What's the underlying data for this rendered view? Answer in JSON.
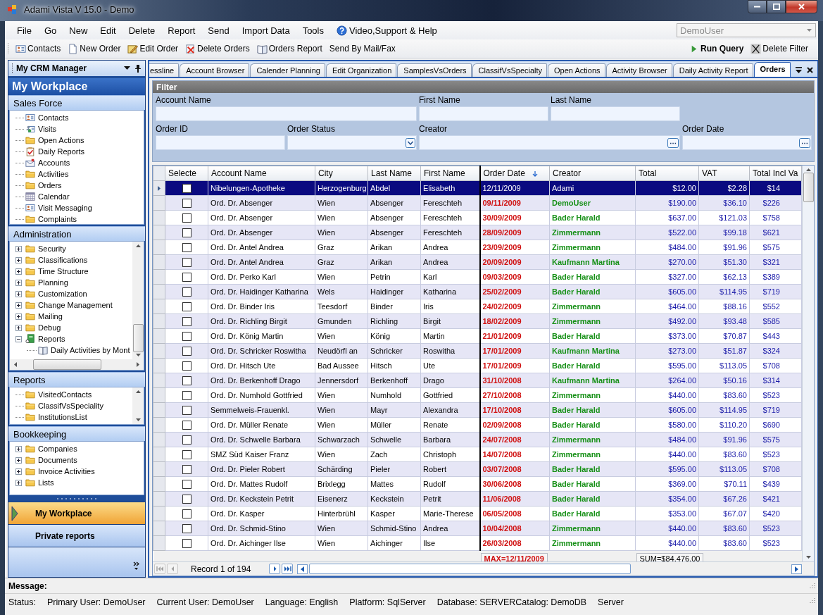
{
  "window": {
    "title": "Adami Vista V 15.0 - Demo"
  },
  "menu": [
    {
      "label": "File",
      "kind": "plain"
    },
    {
      "label": "Go",
      "kind": "plain"
    },
    {
      "label": "New",
      "kind": "plain"
    },
    {
      "label": "Edit",
      "kind": "plain"
    },
    {
      "label": "Delete",
      "kind": "plain"
    },
    {
      "label": "Report",
      "kind": "plain"
    },
    {
      "label": "Send",
      "kind": "plain"
    },
    {
      "label": "Import Data",
      "kind": "plain"
    },
    {
      "label": "Tools",
      "kind": "plain"
    },
    {
      "label": "Video,Support & Help",
      "kind": "help"
    }
  ],
  "user_combo": {
    "value": "DemoUser",
    "disabled": true
  },
  "toolbar": [
    {
      "label": "Contacts",
      "kind": "card"
    },
    {
      "label": "New Order",
      "kind": "document"
    },
    {
      "label": "Edit Order",
      "kind": "pencil"
    },
    {
      "label": "Delete Orders",
      "kind": "delete"
    },
    {
      "label": "Orders Report",
      "kind": "openbook"
    },
    {
      "label": "Send By Mail/Fax",
      "kind": "plain"
    }
  ],
  "query_toolbar": [
    {
      "label": "Run Query",
      "kind": "play"
    },
    {
      "label": "Delete Filter",
      "kind": "x"
    }
  ],
  "sidebar": {
    "title": "My CRM Manager",
    "workplace": "My Workplace",
    "groups": [
      {
        "title": "Sales Force",
        "kind": "flat",
        "items": [
          {
            "label": "Contacts",
            "kind": "card"
          },
          {
            "label": "Visits",
            "kind": "people"
          },
          {
            "label": "Open Actions",
            "kind": "folder"
          },
          {
            "label": "Daily Reports",
            "kind": "clipboard"
          },
          {
            "label": "Accounts",
            "kind": "envelope"
          },
          {
            "label": "Activities",
            "kind": "folder"
          },
          {
            "label": "Orders",
            "kind": "folder"
          },
          {
            "label": "Calendar",
            "kind": "calendar"
          },
          {
            "label": "Visit Messaging",
            "kind": "card"
          },
          {
            "label": "Complaints",
            "kind": "folder"
          }
        ]
      },
      {
        "title": "Administration",
        "kind": "scroll2",
        "items": [
          {
            "label": "Security",
            "kind": "folder",
            "expanded": false
          },
          {
            "label": "Classifications",
            "kind": "folder",
            "expanded": false
          },
          {
            "label": "Time Structure",
            "kind": "folder",
            "expanded": false
          },
          {
            "label": "Planning",
            "kind": "folder",
            "expanded": false
          },
          {
            "label": "Customization",
            "kind": "folder",
            "expanded": false
          },
          {
            "label": "Change Management",
            "kind": "folder",
            "expanded": false
          },
          {
            "label": "Mailing",
            "kind": "folder",
            "expanded": false
          },
          {
            "label": "Debug",
            "kind": "folder",
            "expanded": false
          },
          {
            "label": "Reports",
            "kind": "book",
            "expanded": true,
            "children": [
              {
                "label": "Daily Activities by Mont",
                "kind": "openbook"
              }
            ]
          }
        ]
      },
      {
        "title": "Reports",
        "kind": "scroll1",
        "items": [
          {
            "label": "VisitedContacts",
            "kind": "folder"
          },
          {
            "label": "ClassifVsSpeciality",
            "kind": "folder"
          },
          {
            "label": "InstitutionsList",
            "kind": "folder"
          }
        ]
      },
      {
        "title": "Bookkeeping",
        "kind": "flat",
        "items": [
          {
            "label": "Companies",
            "kind": "folder",
            "expanded": false
          },
          {
            "label": "Documents",
            "kind": "folder",
            "expanded": false
          },
          {
            "label": "Invoice Activities",
            "kind": "folder",
            "expanded": false
          },
          {
            "label": "Lists",
            "kind": "folder",
            "expanded": false
          }
        ]
      }
    ],
    "nav_buttons": [
      {
        "label": "My Workplace",
        "selected": true
      },
      {
        "label": "Private reports",
        "selected": false
      }
    ]
  },
  "tabs": [
    {
      "label": "essline",
      "selected": false
    },
    {
      "label": "Account Browser",
      "selected": false
    },
    {
      "label": "Calender Planning",
      "selected": false
    },
    {
      "label": "Edit Organization",
      "selected": false
    },
    {
      "label": "SamplesVsOrders",
      "selected": false
    },
    {
      "label": "ClassifVsSpecialty",
      "selected": false
    },
    {
      "label": "Open Actions",
      "selected": false
    },
    {
      "label": "Activity Browser",
      "selected": false
    },
    {
      "label": "Daily Activity Report",
      "selected": false
    },
    {
      "label": "Orders",
      "selected": true
    }
  ],
  "filter": {
    "title": "Filter",
    "fields": [
      {
        "label": "Account Name",
        "kind": "wide"
      },
      {
        "label": "First Name",
        "kind": "text"
      },
      {
        "label": "Last Name",
        "kind": "text"
      },
      {
        "label": "Order ID",
        "kind": "text"
      },
      {
        "label": "Order Status",
        "kind": "combo"
      },
      {
        "label": "Creator",
        "kind": "wide_lookup"
      },
      {
        "label": "Order Date",
        "kind": "lookup"
      }
    ]
  },
  "table": {
    "check_column": {
      "label": "Selecte"
    },
    "columns": [
      {
        "label": "Account Name",
        "kind": "text",
        "sorted": false
      },
      {
        "label": "City",
        "kind": "text",
        "sorted": false
      },
      {
        "label": "Last Name",
        "kind": "text",
        "sorted": false
      },
      {
        "label": "First Name",
        "kind": "text",
        "sorted": false
      },
      {
        "label": "Order Date",
        "kind": "date",
        "sorted": true,
        "summary": "MAX=12/11/2009"
      },
      {
        "label": "Creator",
        "kind": "creator",
        "sorted": false
      },
      {
        "label": "Total",
        "kind": "money",
        "sorted": false,
        "summary": "SUM=$84,476.00"
      },
      {
        "label": "VAT",
        "kind": "money",
        "sorted": false
      },
      {
        "label": "Total Incl Va",
        "kind": "cut",
        "sorted": false
      }
    ],
    "rows": [
      {
        "selected": true,
        "checked": false,
        "cells": [
          "Nibelungen-Apotheke",
          "Herzogenburg",
          "Abdel",
          "Elisabeth",
          "12/11/2009",
          "Adami",
          "$12.00",
          "$2.28",
          "$14"
        ]
      },
      {
        "selected": false,
        "checked": false,
        "cells": [
          "Ord. Dr. Absenger",
          "Wien",
          "Absenger",
          "Fereschteh",
          "09/11/2009",
          "DemoUser",
          "$190.00",
          "$36.10",
          "$226"
        ]
      },
      {
        "selected": false,
        "checked": false,
        "cells": [
          "Ord. Dr. Absenger",
          "Wien",
          "Absenger",
          "Fereschteh",
          "30/09/2009",
          "Bader Harald",
          "$637.00",
          "$121.03",
          "$758"
        ]
      },
      {
        "selected": false,
        "checked": false,
        "cells": [
          "Ord. Dr. Absenger",
          "Wien",
          "Absenger",
          "Fereschteh",
          "28/09/2009",
          "Zimmermann",
          "$522.00",
          "$99.18",
          "$621"
        ]
      },
      {
        "selected": false,
        "checked": false,
        "cells": [
          "Ord. Dr. Antel Andrea",
          "Graz",
          "Arikan",
          "Andrea",
          "23/09/2009",
          "Zimmermann",
          "$484.00",
          "$91.96",
          "$575"
        ]
      },
      {
        "selected": false,
        "checked": false,
        "cells": [
          "Ord. Dr. Antel Andrea",
          "Graz",
          "Arikan",
          "Andrea",
          "20/09/2009",
          "Kaufmann Martina",
          "$270.00",
          "$51.30",
          "$321"
        ]
      },
      {
        "selected": false,
        "checked": false,
        "cells": [
          "Ord. Dr. Perko Karl",
          "Wien",
          "Petrin",
          "Karl",
          "09/03/2009",
          "Bader Harald",
          "$327.00",
          "$62.13",
          "$389"
        ]
      },
      {
        "selected": false,
        "checked": false,
        "cells": [
          "Ord. Dr. Haidinger Katharina",
          "Wels",
          "Haidinger",
          "Katharina",
          "25/02/2009",
          "Bader Harald",
          "$605.00",
          "$114.95",
          "$719"
        ]
      },
      {
        "selected": false,
        "checked": false,
        "cells": [
          "Ord. Dr. Binder Iris",
          "Teesdorf",
          "Binder",
          "Iris",
          "24/02/2009",
          "Zimmermann",
          "$464.00",
          "$88.16",
          "$552"
        ]
      },
      {
        "selected": false,
        "checked": false,
        "cells": [
          "Ord. Dr. Richling Birgit",
          "Gmunden",
          "Richling",
          "Birgit",
          "18/02/2009",
          "Zimmermann",
          "$492.00",
          "$93.48",
          "$585"
        ]
      },
      {
        "selected": false,
        "checked": false,
        "cells": [
          "Ord. Dr. König Martin",
          "Wien",
          "König",
          "Martin",
          "21/01/2009",
          "Bader Harald",
          "$373.00",
          "$70.87",
          "$443"
        ]
      },
      {
        "selected": false,
        "checked": false,
        "cells": [
          "Ord. Dr. Schricker Roswitha",
          "Neudörfl an",
          "Schricker",
          "Roswitha",
          "17/01/2009",
          "Kaufmann Martina",
          "$273.00",
          "$51.87",
          "$324"
        ]
      },
      {
        "selected": false,
        "checked": false,
        "cells": [
          "Ord. Dr. Hitsch Ute",
          "Bad Aussee",
          "Hitsch",
          "Ute",
          "17/01/2009",
          "Bader Harald",
          "$595.00",
          "$113.05",
          "$708"
        ]
      },
      {
        "selected": false,
        "checked": false,
        "cells": [
          "Ord. Dr. Berkenhoff Drago",
          "Jennersdorf",
          "Berkenhoff",
          "Drago",
          "31/10/2008",
          "Kaufmann Martina",
          "$264.00",
          "$50.16",
          "$314"
        ]
      },
      {
        "selected": false,
        "checked": false,
        "cells": [
          "Ord. Dr. Numhold Gottfried",
          "Wien",
          "Numhold",
          "Gottfried",
          "27/10/2008",
          "Zimmermann",
          "$440.00",
          "$83.60",
          "$523"
        ]
      },
      {
        "selected": false,
        "checked": false,
        "cells": [
          "Semmelweis-Frauenkl.",
          "Wien",
          "Mayr",
          "Alexandra",
          "17/10/2008",
          "Bader Harald",
          "$605.00",
          "$114.95",
          "$719"
        ]
      },
      {
        "selected": false,
        "checked": false,
        "cells": [
          "Ord. Dr. Müller Renate",
          "Wien",
          "Müller",
          "Renate",
          "02/09/2008",
          "Bader Harald",
          "$580.00",
          "$110.20",
          "$690"
        ]
      },
      {
        "selected": false,
        "checked": false,
        "cells": [
          "Ord. Dr. Schwelle Barbara",
          "Schwarzach",
          "Schwelle",
          "Barbara",
          "24/07/2008",
          "Zimmermann",
          "$484.00",
          "$91.96",
          "$575"
        ]
      },
      {
        "selected": false,
        "checked": false,
        "cells": [
          "SMZ Süd Kaiser Franz",
          "Wien",
          "Zach",
          "Christoph",
          "14/07/2008",
          "Zimmermann",
          "$440.00",
          "$83.60",
          "$523"
        ]
      },
      {
        "selected": false,
        "checked": false,
        "cells": [
          "Ord. Dr. Pieler Robert",
          "Schärding",
          "Pieler",
          "Robert",
          "03/07/2008",
          "Bader Harald",
          "$595.00",
          "$113.05",
          "$708"
        ]
      },
      {
        "selected": false,
        "checked": false,
        "cells": [
          "Ord. Dr. Mattes Rudolf",
          "Brixlegg",
          "Mattes",
          "Rudolf",
          "30/06/2008",
          "Bader Harald",
          "$369.00",
          "$70.11",
          "$439"
        ]
      },
      {
        "selected": false,
        "checked": false,
        "cells": [
          "Ord. Dr. Keckstein Petrit",
          "Eisenerz",
          "Keckstein",
          "Petrit",
          "11/06/2008",
          "Bader Harald",
          "$354.00",
          "$67.26",
          "$421"
        ]
      },
      {
        "selected": false,
        "checked": false,
        "cells": [
          "Ord. Dr. Kasper",
          "Hinterbrühl",
          "Kasper",
          "Marie-Therese",
          "06/05/2008",
          "Bader Harald",
          "$353.00",
          "$67.07",
          "$420"
        ]
      },
      {
        "selected": false,
        "checked": false,
        "cells": [
          "Ord. Dr. Schmid-Stino",
          "Wien",
          "Schmid-Stino",
          "Andrea",
          "10/04/2008",
          "Zimmermann",
          "$440.00",
          "$83.60",
          "$523"
        ]
      },
      {
        "selected": false,
        "checked": false,
        "cells": [
          "Ord. Dr. Aichinger Ilse",
          "Wien",
          "Aichinger",
          "Ilse",
          "26/03/2008",
          "Zimmermann",
          "$440.00",
          "$83.60",
          "$523"
        ]
      }
    ]
  },
  "pager": {
    "buttons": [
      {
        "kind": "first",
        "disabled": true
      },
      {
        "kind": "prev",
        "disabled": true
      },
      {
        "kind": "text",
        "label": "Record 1 of 194"
      },
      {
        "kind": "next",
        "disabled": false
      },
      {
        "kind": "last",
        "disabled": false
      }
    ]
  },
  "message": {
    "label": "Message:"
  },
  "status_bar": [
    "Status:",
    "Primary User: DemoUser",
    "Current User: DemoUser",
    "Language: English",
    "Platform: SqlServer",
    "Database: SERVERCatalog: DemoDB",
    "Server"
  ]
}
